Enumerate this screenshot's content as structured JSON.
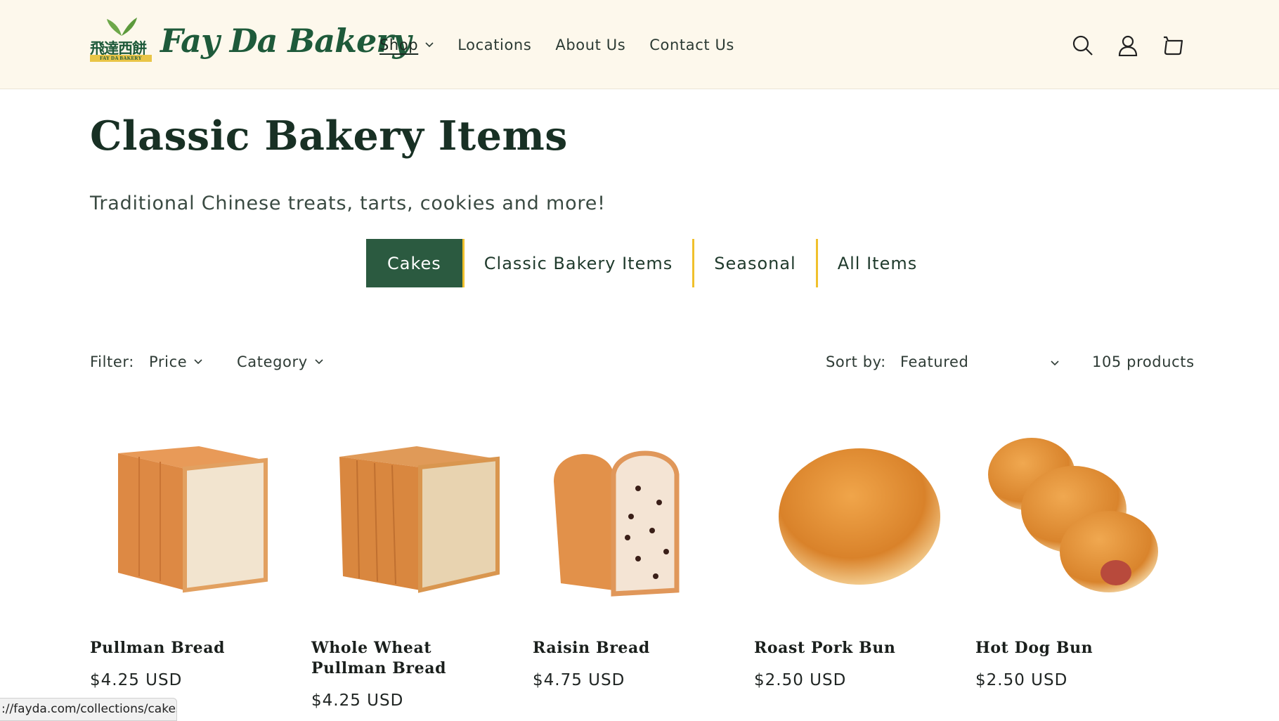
{
  "header": {
    "logo_chinese": "飛達西餅",
    "logo_band": "FAY DA BAKERY",
    "logo_script": "Fay Da Bakery",
    "nav": [
      {
        "label": "Shop",
        "has_dropdown": true
      },
      {
        "label": "Locations"
      },
      {
        "label": "About Us"
      },
      {
        "label": "Contact Us"
      }
    ],
    "icons": [
      "search-icon",
      "account-icon",
      "cart-icon"
    ]
  },
  "page": {
    "title": "Classic Bakery Items",
    "subtitle": "Traditional Chinese treats, tarts, cookies and more!"
  },
  "tabs": [
    {
      "label": "Cakes",
      "active": true
    },
    {
      "label": "Classic Bakery Items",
      "active": false
    },
    {
      "label": "Seasonal",
      "active": false
    },
    {
      "label": "All Items",
      "active": false
    }
  ],
  "filters": {
    "filter_label": "Filter:",
    "price_label": "Price",
    "category_label": "Category",
    "sort_label": "Sort by:",
    "sort_value": "Featured",
    "product_count": "105 products"
  },
  "products": [
    {
      "name": "Pullman Bread",
      "price": "$4.25 USD",
      "image": "pullman-bread"
    },
    {
      "name": "Whole Wheat Pullman Bread",
      "price": "$4.25 USD",
      "image": "whole-wheat-pullman-bread"
    },
    {
      "name": "Raisin Bread",
      "price": "$4.75 USD",
      "image": "raisin-bread"
    },
    {
      "name": "Roast Pork Bun",
      "price": "$2.50 USD",
      "image": "roast-pork-bun"
    },
    {
      "name": "Hot Dog Bun",
      "price": "$2.50 USD",
      "image": "hot-dog-bun"
    }
  ],
  "status_url": "://fayda.com/collections/cakes",
  "colors": {
    "header_bg": "#fdf8ec",
    "brand_green": "#2b5a40",
    "accent_yellow": "#f0c02c"
  }
}
